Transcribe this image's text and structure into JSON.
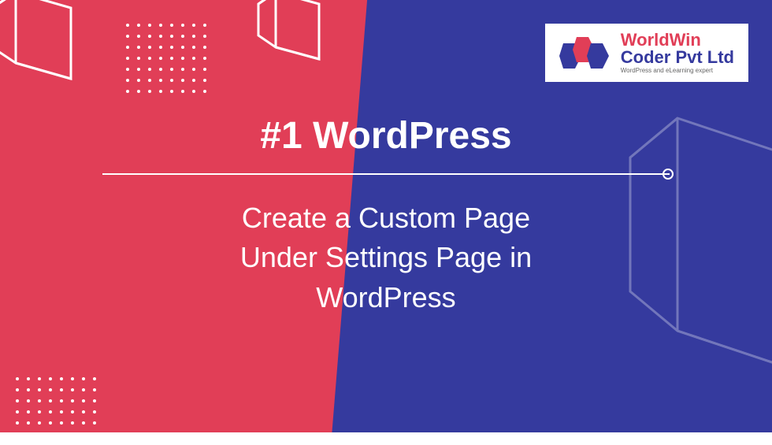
{
  "logo": {
    "line1": "WorldWin",
    "line2": "Coder Pvt Ltd",
    "tagline": "WordPress and eLearning expert"
  },
  "heading": "#1 WordPress",
  "subheading_line1": "Create a Custom Page",
  "subheading_line2": "Under Settings Page in",
  "subheading_line3": "WordPress",
  "colors": {
    "red": "#e13e57",
    "blue": "#353a9e"
  }
}
